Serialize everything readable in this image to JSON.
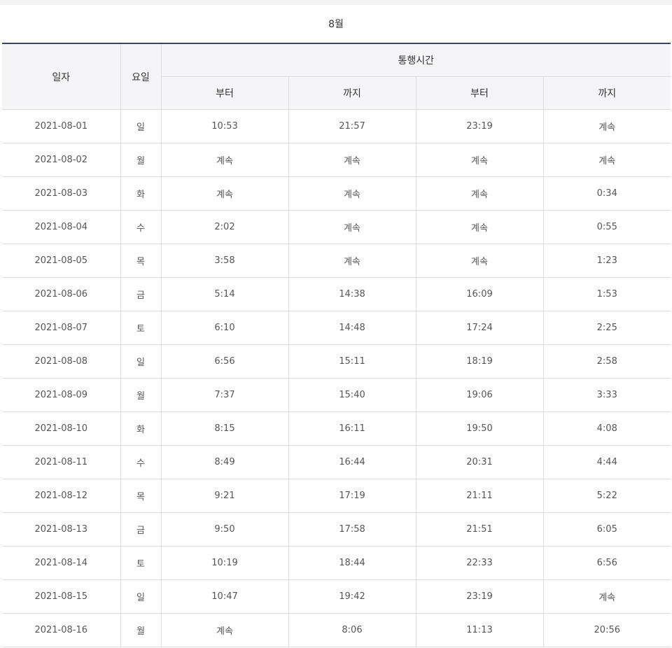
{
  "month": "8월",
  "headers": {
    "date": "일자",
    "dow": "요일",
    "group": "통행시간",
    "from1": "부터",
    "to1": "까지",
    "from2": "부터",
    "to2": "까지"
  },
  "rows": [
    {
      "date": "2021-08-01",
      "dow": "일",
      "from1": "10:53",
      "to1": "21:57",
      "from2": "23:19",
      "to2": "계속"
    },
    {
      "date": "2021-08-02",
      "dow": "월",
      "from1": "계속",
      "to1": "계속",
      "from2": "계속",
      "to2": "계속"
    },
    {
      "date": "2021-08-03",
      "dow": "화",
      "from1": "계속",
      "to1": "계속",
      "from2": "계속",
      "to2": "0:34"
    },
    {
      "date": "2021-08-04",
      "dow": "수",
      "from1": "2:02",
      "to1": "계속",
      "from2": "계속",
      "to2": "0:55"
    },
    {
      "date": "2021-08-05",
      "dow": "목",
      "from1": "3:58",
      "to1": "계속",
      "from2": "계속",
      "to2": "1:23"
    },
    {
      "date": "2021-08-06",
      "dow": "금",
      "from1": "5:14",
      "to1": "14:38",
      "from2": "16:09",
      "to2": "1:53"
    },
    {
      "date": "2021-08-07",
      "dow": "토",
      "from1": "6:10",
      "to1": "14:48",
      "from2": "17:24",
      "to2": "2:25"
    },
    {
      "date": "2021-08-08",
      "dow": "일",
      "from1": "6:56",
      "to1": "15:11",
      "from2": "18:19",
      "to2": "2:58"
    },
    {
      "date": "2021-08-09",
      "dow": "월",
      "from1": "7:37",
      "to1": "15:40",
      "from2": "19:06",
      "to2": "3:33"
    },
    {
      "date": "2021-08-10",
      "dow": "화",
      "from1": "8:15",
      "to1": "16:11",
      "from2": "19:50",
      "to2": "4:08"
    },
    {
      "date": "2021-08-11",
      "dow": "수",
      "from1": "8:49",
      "to1": "16:44",
      "from2": "20:31",
      "to2": "4:44"
    },
    {
      "date": "2021-08-12",
      "dow": "목",
      "from1": "9:21",
      "to1": "17:19",
      "from2": "21:11",
      "to2": "5:22"
    },
    {
      "date": "2021-08-13",
      "dow": "금",
      "from1": "9:50",
      "to1": "17:58",
      "from2": "21:51",
      "to2": "6:05"
    },
    {
      "date": "2021-08-14",
      "dow": "토",
      "from1": "10:19",
      "to1": "18:44",
      "from2": "22:33",
      "to2": "6:56"
    },
    {
      "date": "2021-08-15",
      "dow": "일",
      "from1": "10:47",
      "to1": "19:42",
      "from2": "23:19",
      "to2": "계속"
    },
    {
      "date": "2021-08-16",
      "dow": "월",
      "from1": "계속",
      "to1": "8:06",
      "from2": "11:13",
      "to2": "20:56"
    }
  ]
}
